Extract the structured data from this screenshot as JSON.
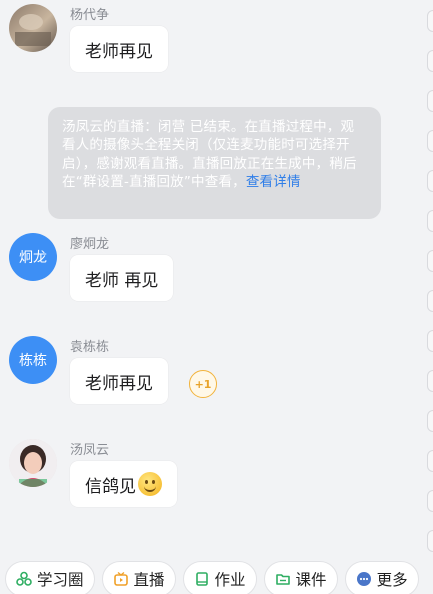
{
  "messages": [
    {
      "sender": "杨代争",
      "text": "老师再见"
    },
    {
      "sender": "廖炯龙",
      "text": "老师 再见",
      "avatar_text": "炯龙"
    },
    {
      "sender": "袁栋栋",
      "text": "老师再见",
      "avatar_text": "栋栋",
      "reaction": "+1"
    },
    {
      "sender": "汤凤云",
      "text": "信鸽见",
      "emoji": "smile-emoji"
    }
  ],
  "notice": {
    "text": "汤凤云的直播：闭营 已结束。在直播过程中，观看人的摄像头全程关闭（仅连麦功能时可选择开启），感谢观看直播。直播回放正在生成中，稍后在“群设置-直播回放”中查看，",
    "link": "查看详情"
  },
  "toolbar": {
    "items": [
      {
        "label": "学习圈",
        "icon": "study-circle-icon",
        "color": "#2fae62"
      },
      {
        "label": "直播",
        "icon": "live-tv-icon",
        "color": "#f0a12a"
      },
      {
        "label": "作业",
        "icon": "homework-book-icon",
        "color": "#2fae62"
      },
      {
        "label": "课件",
        "icon": "folder-icon",
        "color": "#2fae62"
      },
      {
        "label": "更多",
        "icon": "more-dots-icon",
        "color": "#4a76c9"
      }
    ]
  },
  "colors": {
    "avatar_blue": "#3d8ff5",
    "link_blue": "#2f7ee8",
    "background": "#f2f3f5"
  }
}
